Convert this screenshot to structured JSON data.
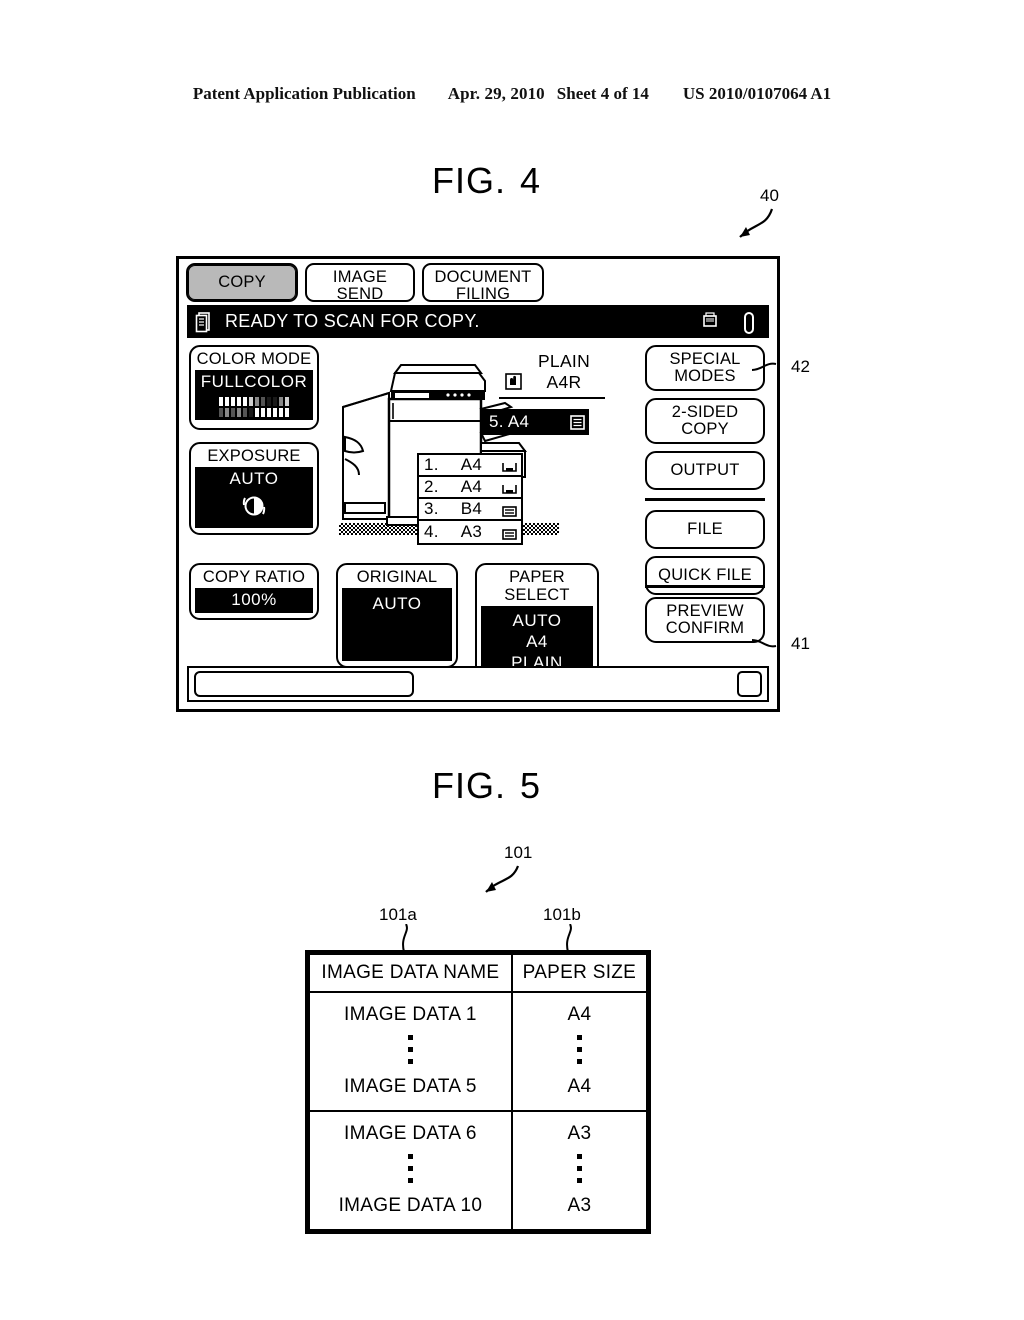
{
  "patent_header": {
    "publication": "Patent Application Publication",
    "date": "Apr. 29, 2010",
    "sheet": "Sheet 4 of 14",
    "number": "US 2010/0107064 A1"
  },
  "figures": {
    "fig4": {
      "label": "FIG.",
      "number": "4"
    },
    "fig5": {
      "label": "FIG.",
      "number": "5"
    }
  },
  "callouts": {
    "panel": "40",
    "preview_confirm": "41",
    "special_modes": "42",
    "table": "101",
    "column_a": "101a",
    "column_b": "101b"
  },
  "panel": {
    "tabs": [
      {
        "label": "COPY",
        "selected": true
      },
      {
        "label_line1": "IMAGE",
        "label_line2": "SEND",
        "selected": false
      },
      {
        "label_line1": "DOCUMENT",
        "label_line2": "FILING",
        "selected": false
      }
    ],
    "tab_labels": {
      "copy": "COPY",
      "image_send_1": "IMAGE",
      "image_send_2": "SEND",
      "document_filing_1": "DOCUMENT",
      "document_filing_2": "FILING"
    },
    "status": {
      "message": "READY TO SCAN FOR COPY.",
      "left_icon": "document-stack-icon",
      "right_icon_1": "printer-data-icon",
      "right_icon_2": "toner-cartridge-icon"
    },
    "left_column": {
      "color_mode": {
        "label": "COLOR MODE",
        "value": "FULLCOLOR"
      },
      "exposure": {
        "label": "EXPOSURE",
        "value": "AUTO",
        "icon": "exposure-contrast-icon"
      }
    },
    "bottom_row": {
      "copy_ratio": {
        "label": "COPY RATIO",
        "value": "100%"
      },
      "original": {
        "label": "ORIGINAL",
        "value": "AUTO"
      },
      "paper_select": {
        "label": "PAPER SELECT",
        "value_line1": "AUTO",
        "value_line2": "A4",
        "value_line3": "PLAIN"
      }
    },
    "trays": [
      {
        "num": "1.",
        "size": "A4",
        "icon": "paper-tray-icon"
      },
      {
        "num": "2.",
        "size": "A4",
        "icon": "paper-tray-icon"
      },
      {
        "num": "3.",
        "size": "B4",
        "icon": "paper-stack-icon"
      },
      {
        "num": "4.",
        "size": "A3",
        "icon": "paper-stack-icon"
      }
    ],
    "bypass": {
      "type": "PLAIN",
      "size": "A4R",
      "hand_icon": "bypass-hand-icon"
    },
    "tray5": {
      "label": "5. A4",
      "icon": "bypass-tray-icon",
      "selected": true
    },
    "right_column": [
      {
        "line1": "SPECIAL",
        "line2": "MODES"
      },
      {
        "line1": "2-SIDED",
        "line2": "COPY"
      },
      {
        "line1": "OUTPUT",
        "line2": ""
      },
      {
        "line1": "FILE",
        "line2": ""
      },
      {
        "line1": "QUICK FILE",
        "line2": ""
      }
    ],
    "right_labels": {
      "special_modes_1": "SPECIAL",
      "special_modes_2": "MODES",
      "two_sided_1": "2-SIDED",
      "two_sided_2": "COPY",
      "output": "OUTPUT",
      "file": "FILE",
      "quick_file": "QUICK FILE",
      "preview_confirm_1": "PREVIEW",
      "preview_confirm_2": "CONFIRM"
    },
    "bottom_bar": {
      "job_field_value": "",
      "corner_button": ""
    }
  },
  "table": {
    "headers": [
      "IMAGE DATA NAME",
      "PAPER SIZE"
    ],
    "groups": [
      {
        "first_name": "IMAGE DATA 1",
        "last_name": "IMAGE DATA 5",
        "first_size": "A4",
        "last_size": "A4"
      },
      {
        "first_name": "IMAGE DATA 6",
        "last_name": "IMAGE DATA 10",
        "first_size": "A3",
        "last_size": "A3"
      }
    ]
  }
}
